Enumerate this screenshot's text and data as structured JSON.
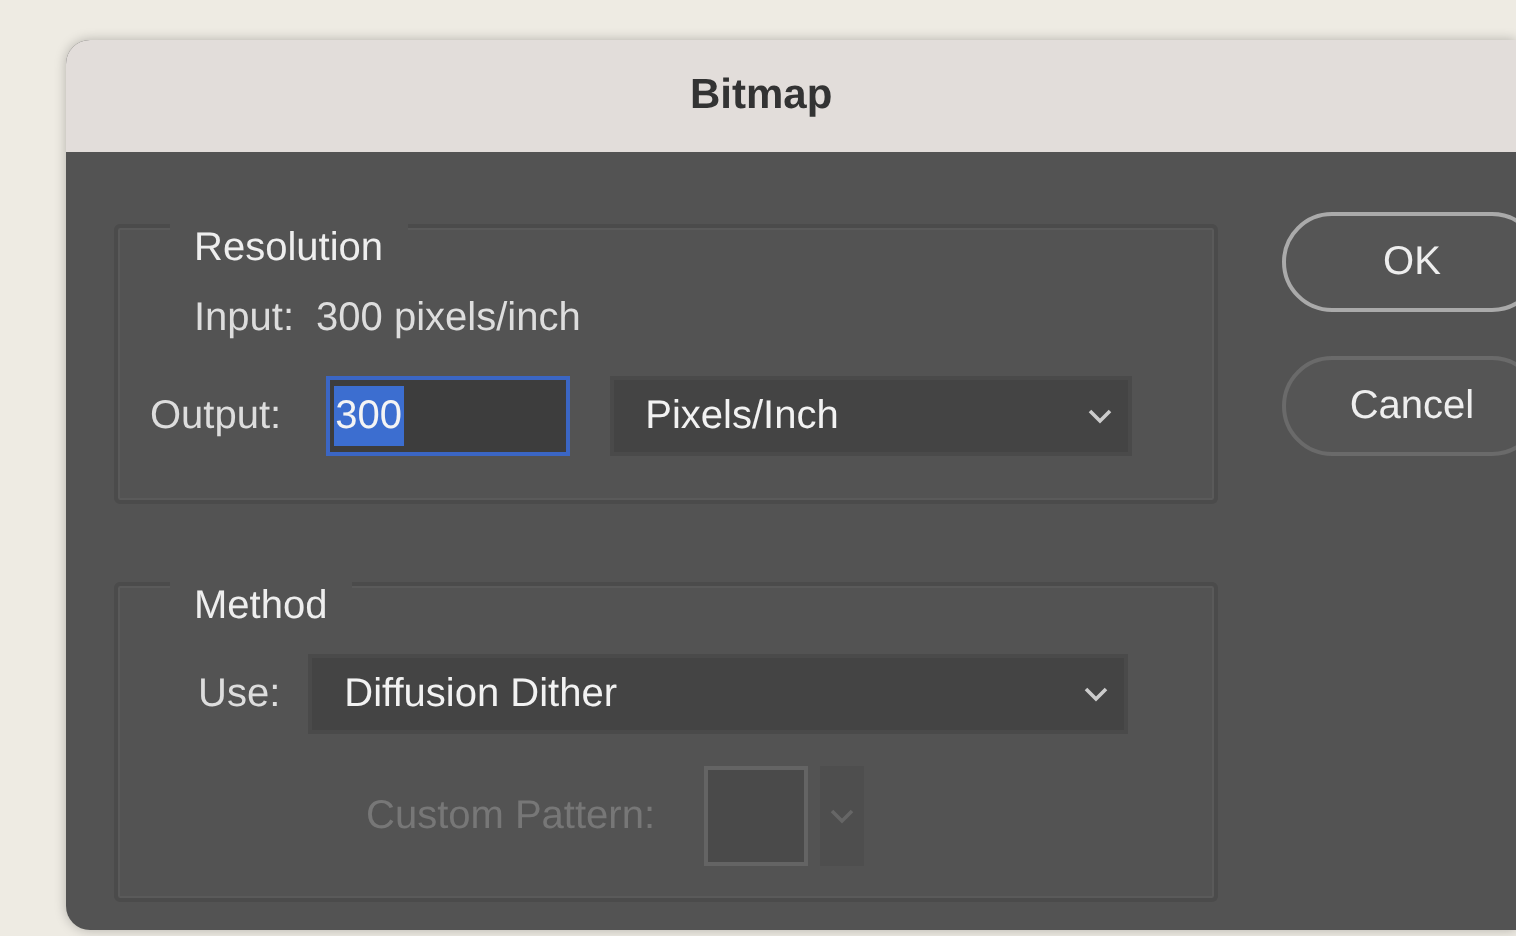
{
  "window": {
    "title": "Bitmap"
  },
  "resolution": {
    "legend": "Resolution",
    "input_label": "Input:",
    "input_value": "300 pixels/inch",
    "output_label": "Output:",
    "output_value": "300",
    "output_focused": true,
    "output_text_selected": true,
    "unit": "Pixels/Inch"
  },
  "method": {
    "legend": "Method",
    "use_label": "Use:",
    "use_value": "Diffusion Dither",
    "custom_pattern": {
      "label": "Custom Pattern:",
      "disabled": true
    }
  },
  "buttons": [
    {
      "label": "OK",
      "default": true
    },
    {
      "label": "Cancel",
      "default": false
    }
  ]
}
